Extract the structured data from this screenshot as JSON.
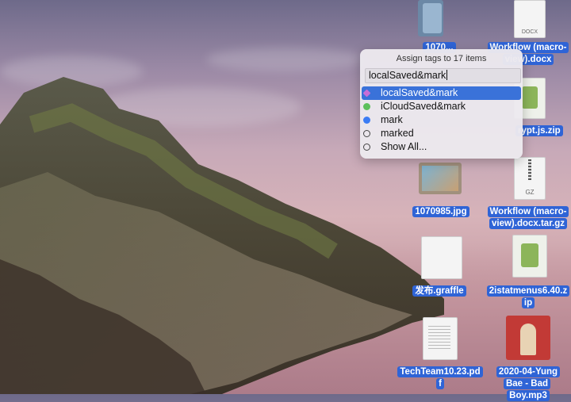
{
  "popover": {
    "title": "Assign tags to 17 items",
    "input_value": "localSaved&mark",
    "tags": [
      {
        "label": "localSaved&mark",
        "color": "#c86dd7",
        "selected": true
      },
      {
        "label": "iCloudSaved&mark",
        "color": "#5cc05c",
        "selected": false
      },
      {
        "label": "mark",
        "color": "#3b7cf4",
        "selected": false
      },
      {
        "label": "marked",
        "color": "none",
        "selected": false
      },
      {
        "label": "Show All...",
        "color": "none",
        "selected": false
      }
    ]
  },
  "desktop": {
    "files": [
      {
        "name": "1070985.jpg",
        "label_lines": [
          "1070985.jpg"
        ]
      },
      {
        "name": "Workflow (macro-view).docx.tar.gz",
        "label_lines": [
          "Workflow (macro-",
          "view).docx.tar.gz"
        ]
      },
      {
        "name": "发布.graffle",
        "label_lines": [
          "发布.graffle"
        ]
      },
      {
        "name": "2istatmenus6.40.zip",
        "label_lines": [
          "2istatmenus6.40.z",
          "ip"
        ]
      },
      {
        "name": "TechTeam10.23.pdf",
        "label_lines": [
          "TechTeam10.23.pd",
          "f"
        ]
      },
      {
        "name": "2020-04-Yung Bae - Bad Boy.mp3",
        "label_lines": [
          "2020-04-Yung",
          "Bae - Bad Boy.mp3"
        ]
      },
      {
        "name": "partial-top-left",
        "label_lines": [
          "1070..."
        ]
      },
      {
        "name": "Workflow (macro-view).docx",
        "label_lines": [
          "Workflow (macro-",
          "view).docx"
        ]
      },
      {
        "name": "crypt.js.zip",
        "label_lines": [
          "rypt.js.zip"
        ]
      }
    ],
    "icon_badges": {
      "docx": "DOCX",
      "gz": "GZ"
    }
  }
}
